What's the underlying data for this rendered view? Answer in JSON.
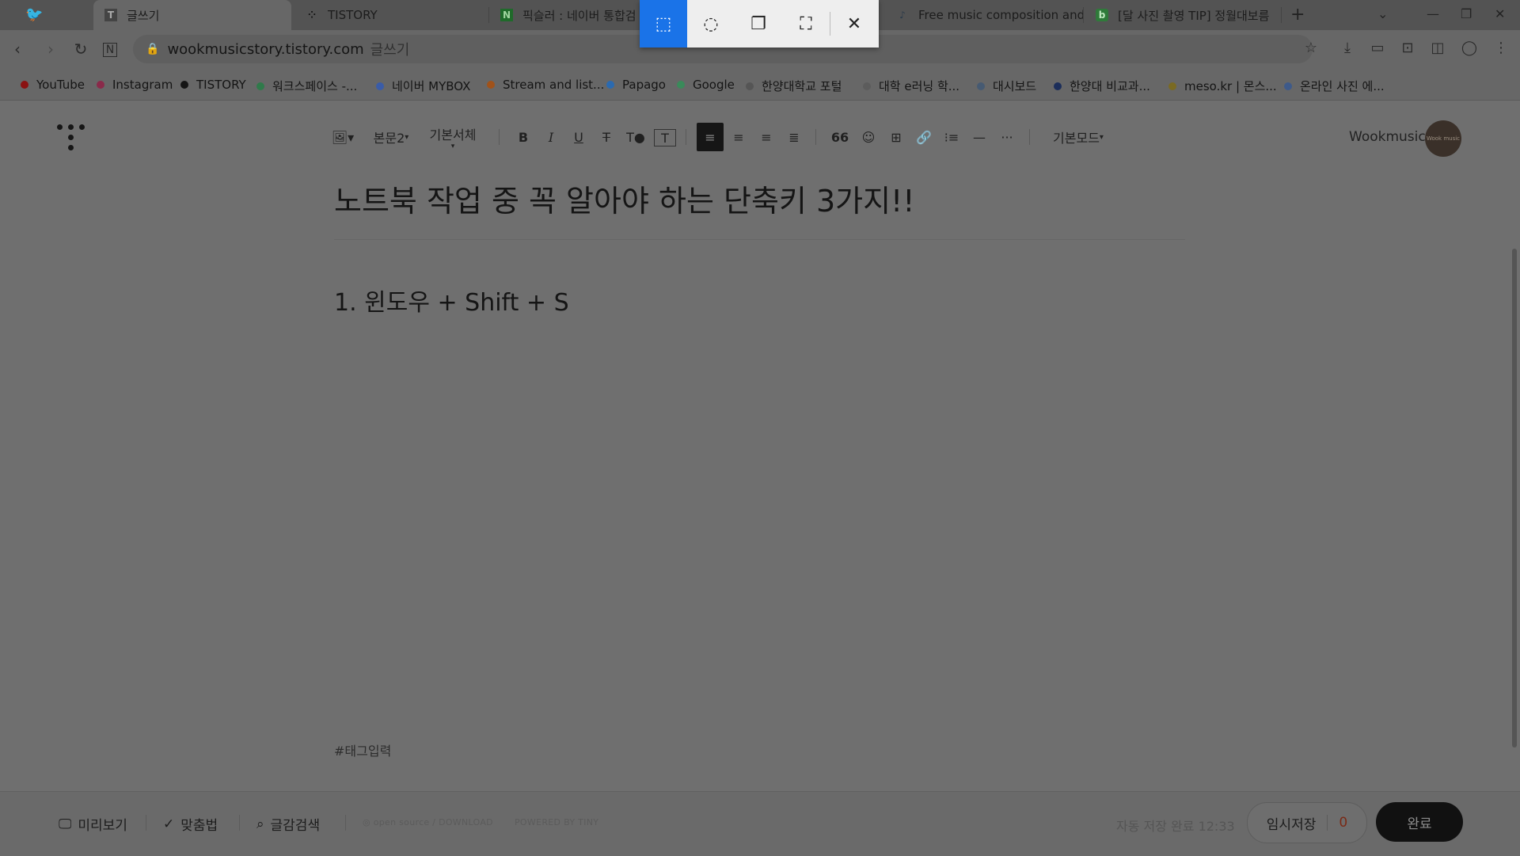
{
  "tabs": [
    {
      "title": "글쓰기",
      "favicon": "T",
      "active": true
    },
    {
      "title": "TISTORY",
      "favicon": "⁘",
      "active": false
    },
    {
      "title": "픽슬러 : 네이버 통합검",
      "favicon": "N",
      "active": false
    },
    {
      "title": "Free music composition and",
      "favicon": "♪",
      "active": false
    },
    {
      "title": "[달 사진 촬영 TIP] 정월대보름",
      "favicon": "b",
      "active": false
    }
  ],
  "address": {
    "url": "wookmusicstory.tistory.com",
    "path": "글쓰기"
  },
  "bookmarks": [
    {
      "label": "YouTube",
      "color": "#8a1212"
    },
    {
      "label": "Instagram",
      "color": "#8a2a4a"
    },
    {
      "label": "TISTORY",
      "color": "#151515"
    },
    {
      "label": "워크스페이스 -...",
      "color": "#2f7a4a"
    },
    {
      "label": "네이버 MYBOX",
      "color": "#3a5ca8"
    },
    {
      "label": "Stream and list...",
      "color": "#a0521a"
    },
    {
      "label": "Papago",
      "color": "#2b6ab0"
    },
    {
      "label": "Google",
      "color": "#3a8a5a"
    },
    {
      "label": "한양대학교 포털",
      "color": "#555555"
    },
    {
      "label": "대학 e러닝 학...",
      "color": "#5c5c5c"
    },
    {
      "label": "대시보드",
      "color": "#465a72"
    },
    {
      "label": "한양대 비교과...",
      "color": "#1c2e5a"
    },
    {
      "label": "meso.kr | 몬스...",
      "color": "#7a6a22"
    },
    {
      "label": "온라인 사진 에...",
      "color": "#3e5a8a"
    }
  ],
  "editor": {
    "paragraph_style": "본문2",
    "font": "기본서체",
    "mode": "기본모드",
    "username": "Wookmusic",
    "avatar_text": "Wook music"
  },
  "content": {
    "title": "노트북 작업 중 꼭 알아야 하는 단축키 3가지!!",
    "heading": "1. 윈도우 + Shift + S",
    "tag_placeholder": "#태그입력"
  },
  "footer": {
    "preview": "미리보기",
    "spellcheck": "맞춤법",
    "search": "글감검색",
    "opensource": "open source / DOWNLOAD",
    "powered": "POWERED BY TINY",
    "autosave": "자동 저장 완료 12:33",
    "temp_save": "임시저장",
    "temp_count": "0",
    "done": "완료"
  }
}
